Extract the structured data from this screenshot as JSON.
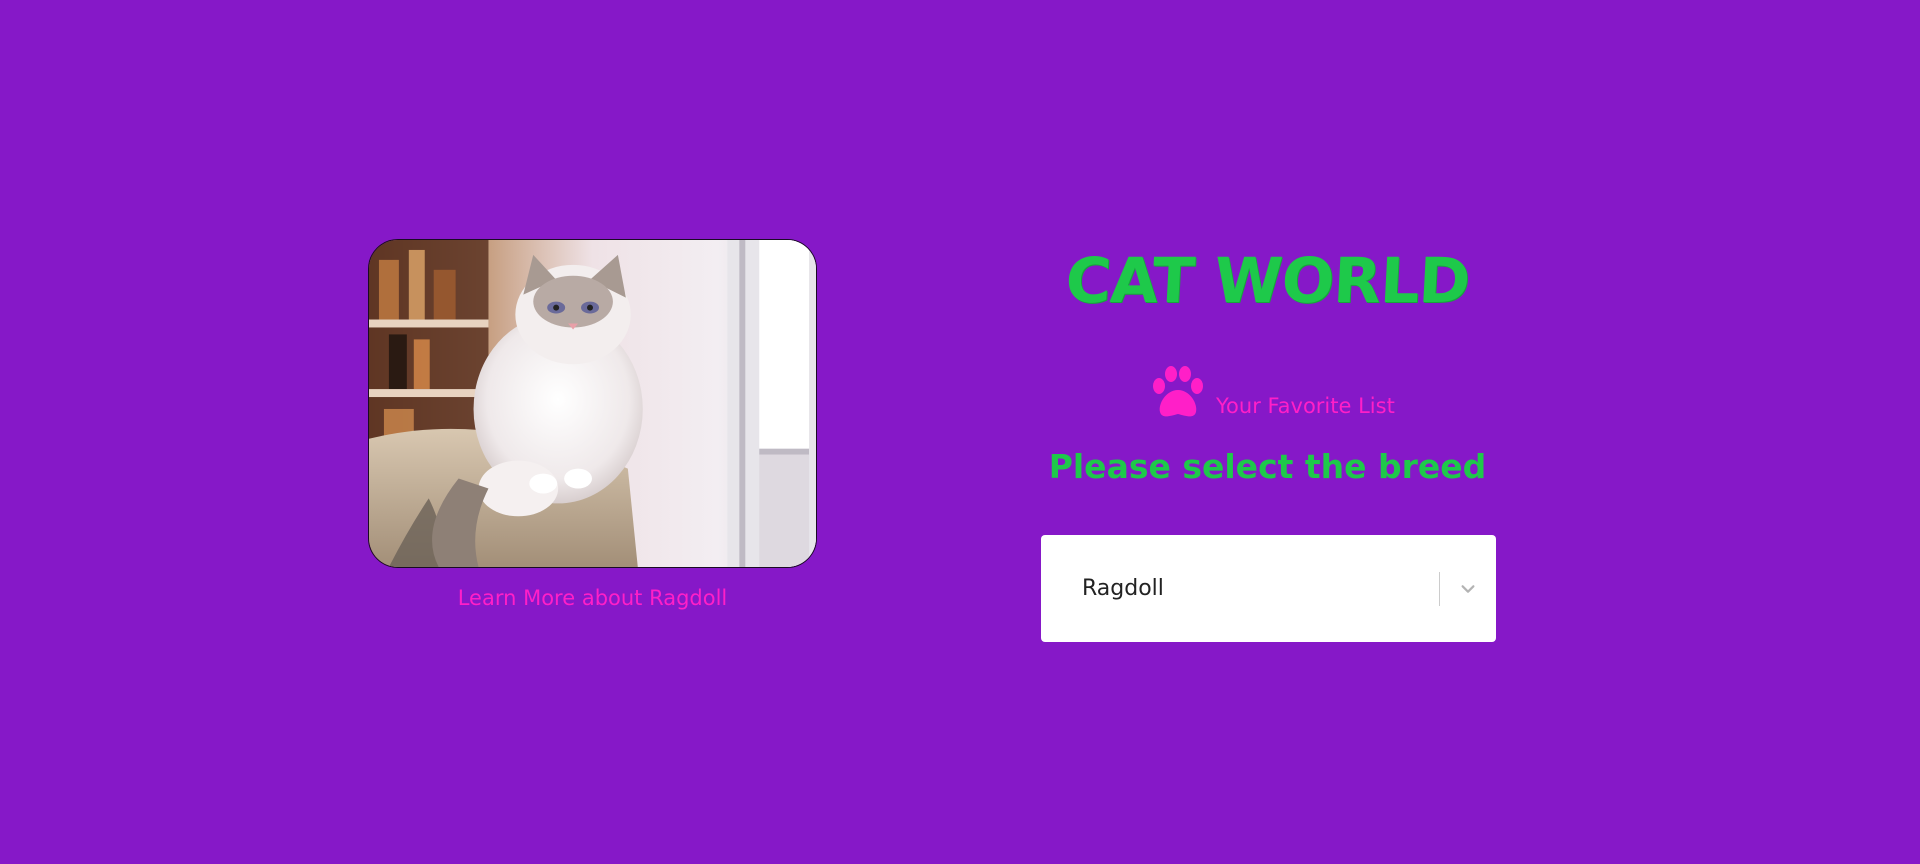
{
  "app": {
    "title": "CAT WORLD",
    "accent_color": "#ff1fc8",
    "brand_color": "#1ec94a",
    "background_color": "#8618c8"
  },
  "photo": {
    "description_icon": "cat-photo",
    "learn_more_label": "Learn More about Ragdoll"
  },
  "favorites": {
    "icon": "paw-icon",
    "label": "Your Favorite List"
  },
  "breed_picker": {
    "heading": "Please select the breed",
    "selected_value": "Ragdoll",
    "icon": "chevron-down-icon"
  }
}
